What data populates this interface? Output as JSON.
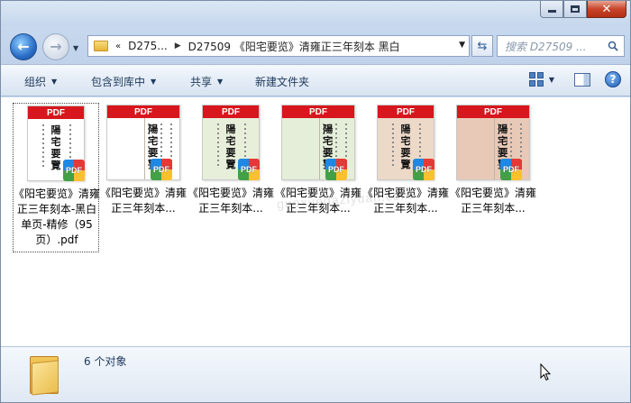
{
  "window": {
    "controls": {
      "minimize": "minimize",
      "maximize": "maximize",
      "close": "close"
    }
  },
  "address": {
    "chevron": "«",
    "segments": [
      "D275...",
      "D27509 《阳宅要览》清雍正三年刻本 黑白"
    ],
    "search_placeholder": "搜索 D27509 ..."
  },
  "commands": {
    "organize": "组织",
    "include_in_library": "包含到库中",
    "share": "共享",
    "new_folder": "新建文件夹"
  },
  "files": [
    {
      "name": "《阳宅要览》清雍正三年刻本-黑白单页-精修（95页）.pdf",
      "display": "《阳宅要览》清雍正三年刻本-黑白单页-精修（95页）.pdf",
      "thumb_style": "bw-single",
      "selected": true
    },
    {
      "name": "《阳宅要览》清雍正三年刻本...",
      "display": "《阳宅要览》清雍正三年刻本...",
      "thumb_style": "bw-spread",
      "selected": false
    },
    {
      "name": "《阳宅要览》清雍正三年刻本...",
      "display": "《阳宅要览》清雍正三年刻本...",
      "thumb_style": "green-single",
      "selected": false
    },
    {
      "name": "《阳宅要览》清雍正三年刻本...",
      "display": "《阳宅要览》清雍正三年刻本...",
      "thumb_style": "green-spread",
      "selected": false
    },
    {
      "name": "《阳宅要览》清雍正三年刻本...",
      "display": "《阳宅要览》清雍正三年刻本...",
      "thumb_style": "color-single",
      "selected": false
    },
    {
      "name": "《阳宅要览》清雍正三年刻本...",
      "display": "《阳宅要览》清雍正三年刻本...",
      "thumb_style": "color-spread",
      "selected": false
    }
  ],
  "thumbnail": {
    "banner": "PDF",
    "badge": "PDF",
    "page_title": "陽宅要覽"
  },
  "watermark": "guoxuedaziyuan.com",
  "status": {
    "item_count": "6 个对象"
  },
  "colors": {
    "accent": "#d7161d",
    "frame": "#c9daee",
    "text": "#1e395b"
  }
}
